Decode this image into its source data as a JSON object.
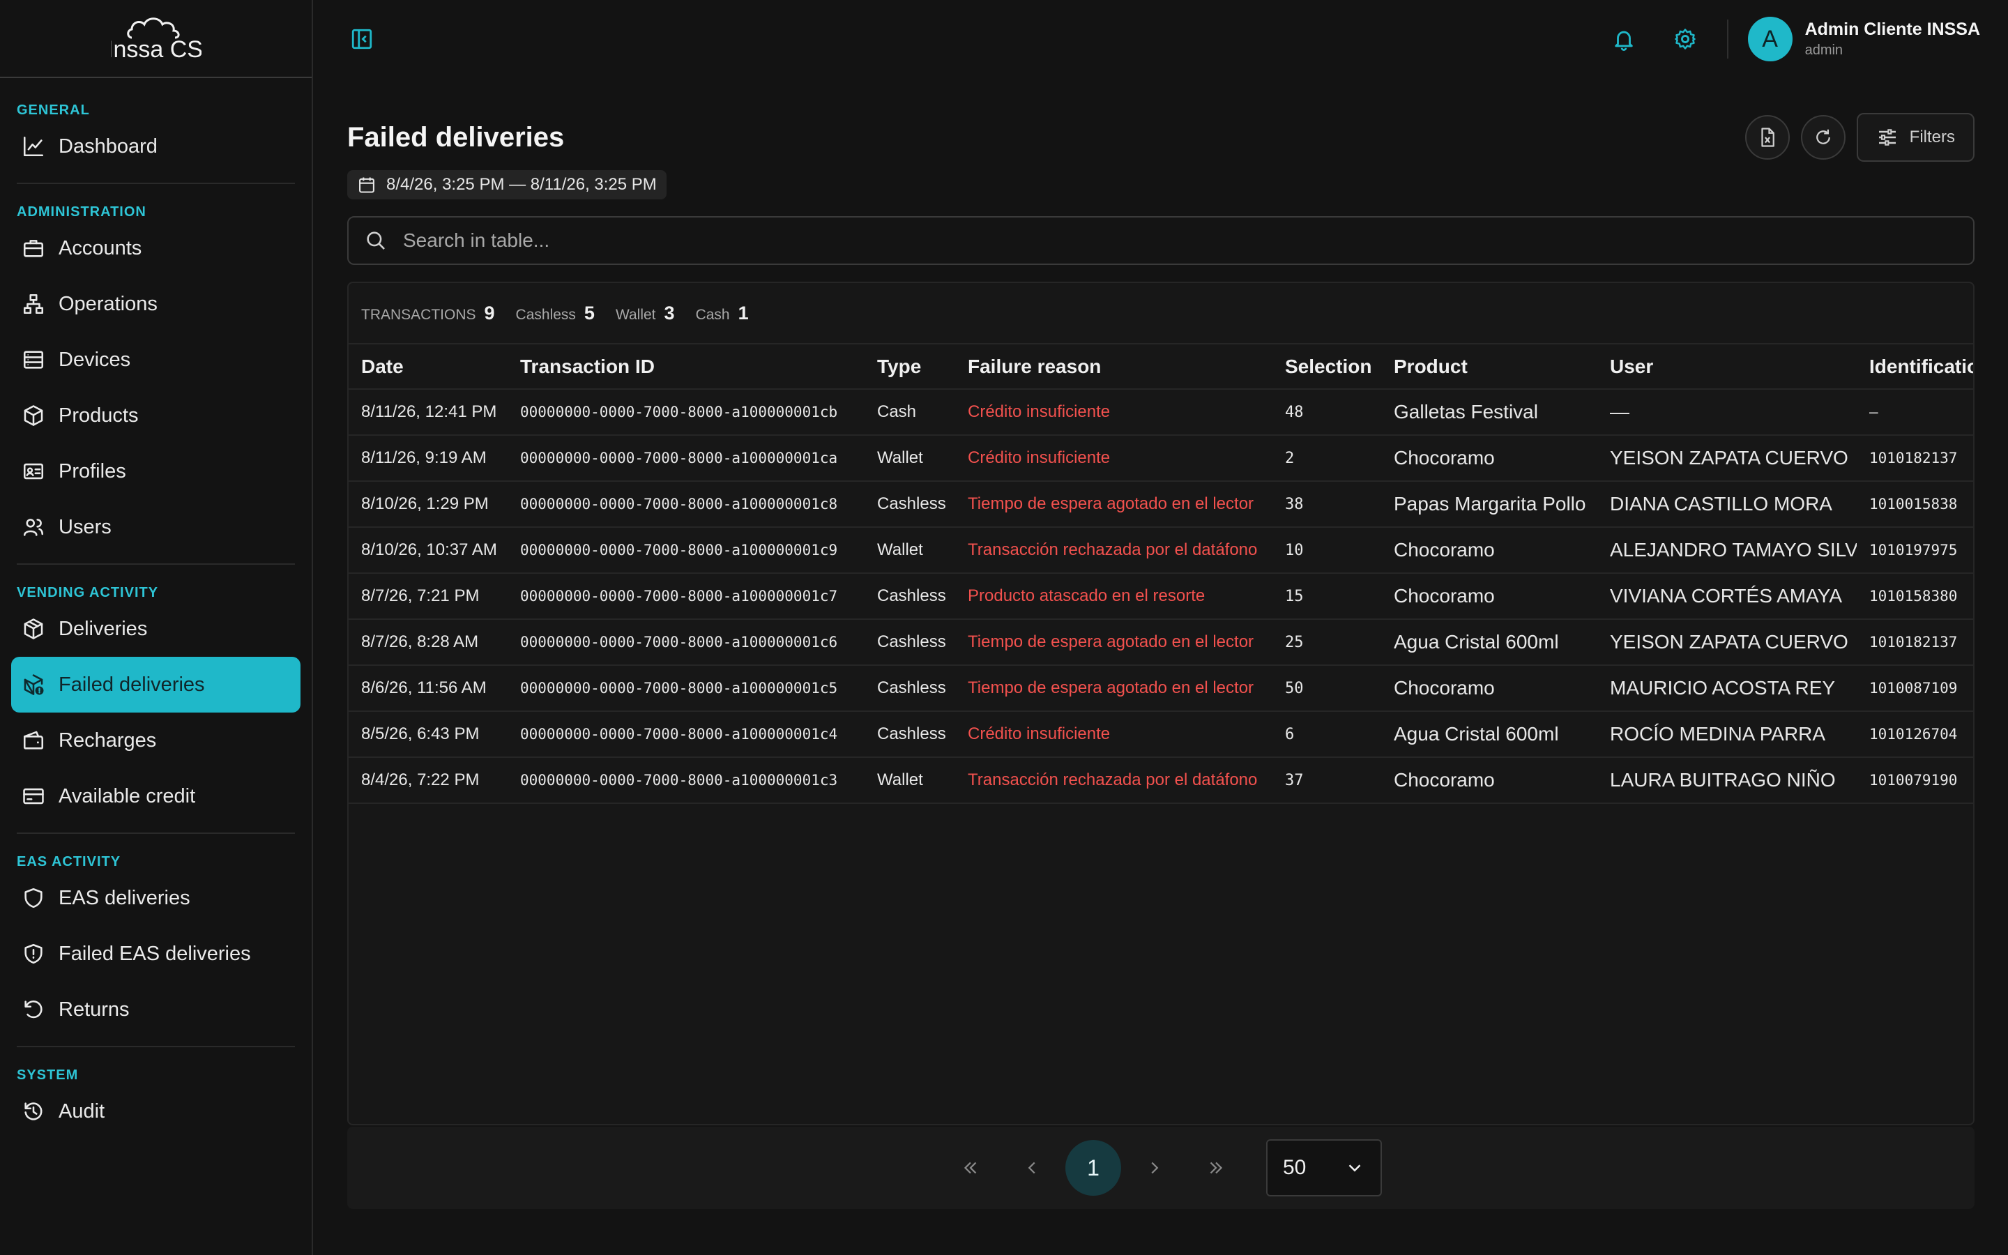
{
  "brand": {
    "name": "Inssa CS"
  },
  "sidebar": {
    "groups": [
      {
        "title": "GENERAL",
        "items": [
          {
            "label": "Dashboard",
            "icon": "chart-line-icon"
          }
        ]
      },
      {
        "title": "ADMINISTRATION",
        "items": [
          {
            "label": "Accounts",
            "icon": "briefcase-icon"
          },
          {
            "label": "Operations",
            "icon": "hierarchy-icon"
          },
          {
            "label": "Devices",
            "icon": "server-icon"
          },
          {
            "label": "Products",
            "icon": "box-icon"
          },
          {
            "label": "Profiles",
            "icon": "id-card-icon"
          },
          {
            "label": "Users",
            "icon": "users-icon"
          }
        ]
      },
      {
        "title": "VENDING ACTIVITY",
        "items": [
          {
            "label": "Deliveries",
            "icon": "package-icon"
          },
          {
            "label": "Failed deliveries",
            "icon": "package-alert-icon",
            "active": true
          },
          {
            "label": "Recharges",
            "icon": "wallet-icon"
          },
          {
            "label": "Available credit",
            "icon": "credit-card-icon"
          }
        ]
      },
      {
        "title": "EAS ACTIVITY",
        "items": [
          {
            "label": "EAS deliveries",
            "icon": "shield-icon"
          },
          {
            "label": "Failed EAS deliveries",
            "icon": "shield-alert-icon"
          },
          {
            "label": "Returns",
            "icon": "undo-icon"
          }
        ]
      },
      {
        "title": "SYSTEM",
        "items": [
          {
            "label": "Audit",
            "icon": "history-icon"
          }
        ]
      }
    ]
  },
  "header": {
    "user": {
      "initial": "A",
      "name": "Admin Cliente INSSA",
      "role": "admin"
    }
  },
  "page": {
    "title": "Failed deliveries",
    "date_range": "8/4/26, 3:25 PM — 8/11/26, 3:25 PM",
    "filters_label": "Filters",
    "search_placeholder": "Search in table..."
  },
  "summary": [
    {
      "label": "TRANSACTIONS",
      "value": "9"
    },
    {
      "label": "Cashless",
      "value": "5"
    },
    {
      "label": "Wallet",
      "value": "3"
    },
    {
      "label": "Cash",
      "value": "1"
    }
  ],
  "table": {
    "columns": [
      "Date",
      "Transaction ID",
      "Type",
      "Failure reason",
      "Selection",
      "Product",
      "User",
      "Identification"
    ],
    "rows": [
      {
        "date": "8/11/26, 12:41 PM",
        "id": "00000000-0000-7000-8000-a100000001cb",
        "type": "Cash",
        "reason": "Crédito insuficiente",
        "selection": "48",
        "product": "Galletas Festival",
        "user": "—",
        "ident": "—"
      },
      {
        "date": "8/11/26, 9:19 AM",
        "id": "00000000-0000-7000-8000-a100000001ca",
        "type": "Wallet",
        "reason": "Crédito insuficiente",
        "selection": "2",
        "product": "Chocoramo",
        "user": "YEISON ZAPATA CUERVO",
        "ident": "1010182137"
      },
      {
        "date": "8/10/26, 1:29 PM",
        "id": "00000000-0000-7000-8000-a100000001c8",
        "type": "Cashless",
        "reason": "Tiempo de espera agotado en el lector",
        "selection": "38",
        "product": "Papas Margarita Pollo",
        "user": "DIANA CASTILLO MORA",
        "ident": "1010015838"
      },
      {
        "date": "8/10/26, 10:37 AM",
        "id": "00000000-0000-7000-8000-a100000001c9",
        "type": "Wallet",
        "reason": "Transacción rechazada por el datáfono",
        "selection": "10",
        "product": "Chocoramo",
        "user": "ALEJANDRO TAMAYO SILVA",
        "ident": "1010197975"
      },
      {
        "date": "8/7/26, 7:21 PM",
        "id": "00000000-0000-7000-8000-a100000001c7",
        "type": "Cashless",
        "reason": "Producto atascado en el resorte",
        "selection": "15",
        "product": "Chocoramo",
        "user": "VIVIANA CORTÉS AMAYA",
        "ident": "1010158380"
      },
      {
        "date": "8/7/26, 8:28 AM",
        "id": "00000000-0000-7000-8000-a100000001c6",
        "type": "Cashless",
        "reason": "Tiempo de espera agotado en el lector",
        "selection": "25",
        "product": "Agua Cristal 600ml",
        "user": "YEISON ZAPATA CUERVO",
        "ident": "1010182137"
      },
      {
        "date": "8/6/26, 11:56 AM",
        "id": "00000000-0000-7000-8000-a100000001c5",
        "type": "Cashless",
        "reason": "Tiempo de espera agotado en el lector",
        "selection": "50",
        "product": "Chocoramo",
        "user": "MAURICIO ACOSTA REY",
        "ident": "1010087109"
      },
      {
        "date": "8/5/26, 6:43 PM",
        "id": "00000000-0000-7000-8000-a100000001c4",
        "type": "Cashless",
        "reason": "Crédito insuficiente",
        "selection": "6",
        "product": "Agua Cristal 600ml",
        "user": "ROCÍO MEDINA PARRA",
        "ident": "1010126704"
      },
      {
        "date": "8/4/26, 7:22 PM",
        "id": "00000000-0000-7000-8000-a100000001c3",
        "type": "Wallet",
        "reason": "Transacción rechazada por el datáfono",
        "selection": "37",
        "product": "Chocoramo",
        "user": "LAURA BUITRAGO NIÑO",
        "ident": "1010079190"
      }
    ]
  },
  "pagination": {
    "current_page": "1",
    "page_size": "50"
  },
  "colors": {
    "accent": "#1fb8c9",
    "error": "#f2514e",
    "background": "#131313"
  }
}
